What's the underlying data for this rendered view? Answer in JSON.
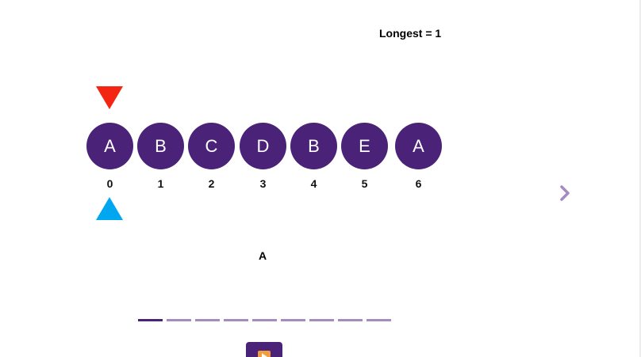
{
  "status": {
    "longest_text": "Longest = 1"
  },
  "pointers": {
    "start_color": "#f22613",
    "end_color": "#00a6f0",
    "start_index": 0,
    "end_index": 0
  },
  "array": {
    "items": [
      {
        "letter": "A",
        "index": "0"
      },
      {
        "letter": "B",
        "index": "1"
      },
      {
        "letter": "C",
        "index": "2"
      },
      {
        "letter": "D",
        "index": "3"
      },
      {
        "letter": "B",
        "index": "4"
      },
      {
        "letter": "E",
        "index": "5"
      },
      {
        "letter": "A",
        "index": "6"
      }
    ],
    "cell_color": "#4a2378"
  },
  "current_substring": "A",
  "navigation": {
    "next_icon": "chevron-right-icon",
    "next_color": "#a48cbf"
  },
  "progress": {
    "total_steps": 9,
    "current_step": 1,
    "active_color": "#4a2378",
    "inactive_color": "#a48cbf"
  },
  "playback": {
    "play_icon": "play-icon",
    "button_color": "#4a2378",
    "icon_color": "#f39c3d"
  }
}
